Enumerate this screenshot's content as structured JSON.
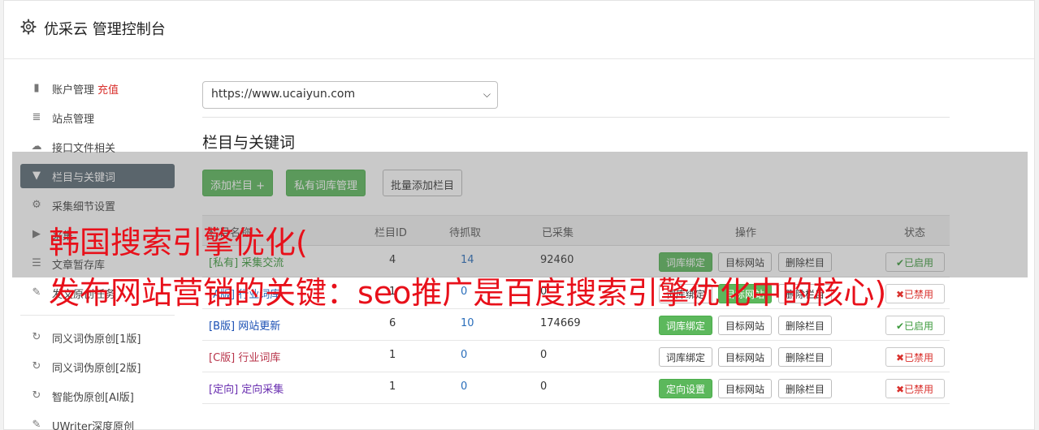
{
  "header": {
    "title": "优采云 管理控制台"
  },
  "sidebar": {
    "items": [
      {
        "label": "账户管理",
        "extra": "充值",
        "icon": "bar-chart-icon",
        "glyph": "▮"
      },
      {
        "label": "站点管理",
        "icon": "server-icon",
        "glyph": "≣"
      },
      {
        "label": "接口文件相关",
        "icon": "cloud-upload-icon",
        "glyph": "☁"
      },
      {
        "label": "栏目与关键词",
        "icon": "filter-icon",
        "glyph": "▼",
        "active": true
      },
      {
        "label": "采集细节设置",
        "icon": "cogs-icon",
        "glyph": "⚙"
      },
      {
        "label": "采集",
        "icon": "play-circle-icon",
        "glyph": "▶"
      },
      {
        "label": "文章暂存库",
        "icon": "database-icon",
        "glyph": "☰"
      },
      {
        "label": "发文原创任务",
        "icon": "edit-icon",
        "glyph": "✎"
      }
    ],
    "items2": [
      {
        "label": "同义词伪原创[1版]",
        "icon": "refresh-icon",
        "glyph": "↻"
      },
      {
        "label": "同义词伪原创[2版]",
        "icon": "refresh-icon",
        "glyph": "↻"
      },
      {
        "label": "智能伪原创[AI版]",
        "icon": "refresh-icon",
        "glyph": "↻"
      },
      {
        "label": "UWriter深度原创",
        "icon": "edit-icon",
        "glyph": "✎"
      }
    ]
  },
  "site_select": {
    "value": "https://www.ucaiyun.com"
  },
  "section": {
    "title": "栏目与关键词"
  },
  "toolbar": {
    "add": "添加栏目 +",
    "private": "私有词库管理",
    "batch": "批量添加栏目"
  },
  "table": {
    "headers": [
      "栏目名称",
      "栏目ID",
      "待抓取",
      "已采集",
      "操作",
      "状态"
    ],
    "rows": [
      {
        "tag": "[私有]",
        "name": "采集交流",
        "color": "#3c9a3c",
        "id": "4",
        "pending": "14",
        "collected": "92460",
        "bind": "词库绑定",
        "bind_green": true,
        "target": "目标网站",
        "target_green": false,
        "del": "删除栏目",
        "status": "✔已启用",
        "on": true
      },
      {
        "tag": "[A版]",
        "name": "行业词库",
        "color": "#2a6ebb",
        "id": "1",
        "pending": "0",
        "collected": "0",
        "bind": "词库绑定",
        "bind_green": false,
        "target": "目标网站",
        "target_green": true,
        "del": "删除栏目",
        "status": "✖已禁用",
        "on": false
      },
      {
        "tag": "[B版]",
        "name": "网站更新",
        "color": "#1a4fb4",
        "id": "6",
        "pending": "10",
        "collected": "174669",
        "bind": "词库绑定",
        "bind_green": true,
        "target": "目标网站",
        "target_green": false,
        "del": "删除栏目",
        "status": "✔已启用",
        "on": true
      },
      {
        "tag": "[C版]",
        "name": "行业词库",
        "color": "#b8344a",
        "id": "1",
        "pending": "0",
        "collected": "0",
        "bind": "词库绑定",
        "bind_green": false,
        "target": "目标网站",
        "target_green": false,
        "del": "删除栏目",
        "status": "✖已禁用",
        "on": false
      },
      {
        "tag": "[定向]",
        "name": "定向采集",
        "color": "#6a2fb0",
        "id": "1",
        "pending": "0",
        "collected": "0",
        "bind": "定向设置",
        "bind_green": true,
        "target": "目标网站",
        "target_green": false,
        "del": "删除栏目",
        "status": "✖已禁用",
        "on": false
      }
    ]
  },
  "overlay": {
    "line1": "韩国搜索引擎优化(",
    "line2": "发布网站营销的关键：seo推广是百度搜索引擎优化中的核心)"
  },
  "colors": {
    "accent": "#5cb85c",
    "nav_active": "#5a6a75",
    "overlay_text": "#e8101a"
  }
}
